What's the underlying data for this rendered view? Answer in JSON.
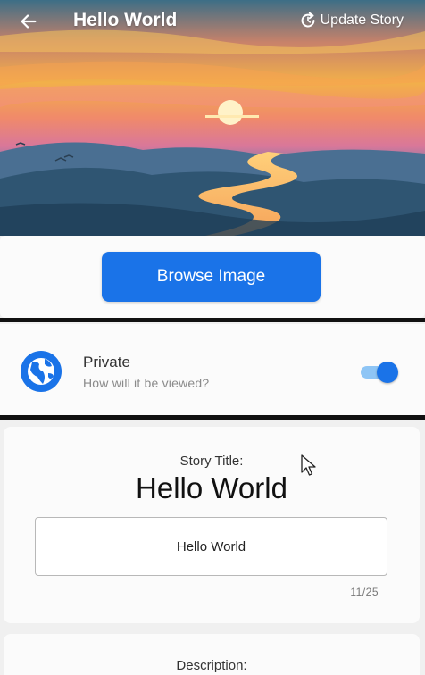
{
  "header": {
    "title": "Hello World",
    "back_icon": "arrow-left-icon",
    "update_label": "Update Story",
    "update_icon": "refresh-icon"
  },
  "browse": {
    "button_label": "Browse Image",
    "accent": "#1a73e8"
  },
  "privacy": {
    "icon": "globe-icon",
    "label": "Private",
    "sublabel": "How will it be viewed?",
    "toggle_on": true
  },
  "story": {
    "title_label": "Story Title:",
    "title_display": "Hello World",
    "title_input_value": "Hello World",
    "counter": "11/25"
  },
  "description": {
    "label": "Description:"
  }
}
